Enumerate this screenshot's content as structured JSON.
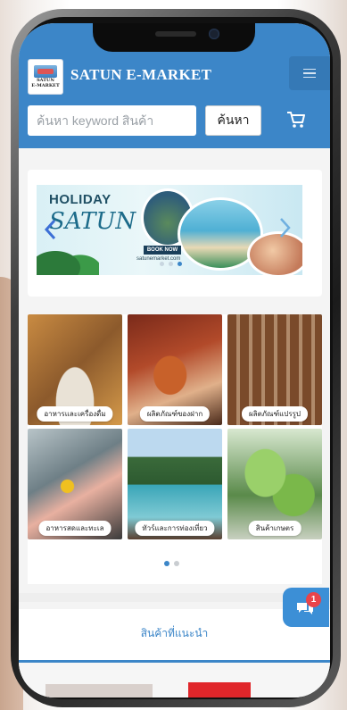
{
  "header": {
    "logo_text_line1": "SATUN",
    "logo_text_line2": "E-MARKET",
    "brand": "SATUN E-MARKET",
    "search_placeholder": "ค้นหา keyword สินค้า",
    "search_button": "ค้นหา"
  },
  "banner": {
    "title": "HOLIDAY",
    "script": "SATUN",
    "book_now": "BOOK NOW",
    "url": "satunemarket.com",
    "slide_count": 3,
    "active_slide": 2
  },
  "categories": [
    {
      "label": "อาหารและเครื่องดื่ม"
    },
    {
      "label": "ผลิตภัณฑ์ของฝาก"
    },
    {
      "label": "ผลิตภัณฑ์แปรรูป"
    },
    {
      "label": "อาหารสดและทะเล"
    },
    {
      "label": "ทัวร์และการท่องเที่ยว"
    },
    {
      "label": "สินค้าเกษตร"
    }
  ],
  "category_pager": {
    "pages": 2,
    "active": 1
  },
  "recommended": {
    "title": "สินค้าที่แนะนำ"
  },
  "chat": {
    "badge": "1"
  },
  "colors": {
    "primary": "#3c86c8",
    "badge": "#e8444a"
  }
}
